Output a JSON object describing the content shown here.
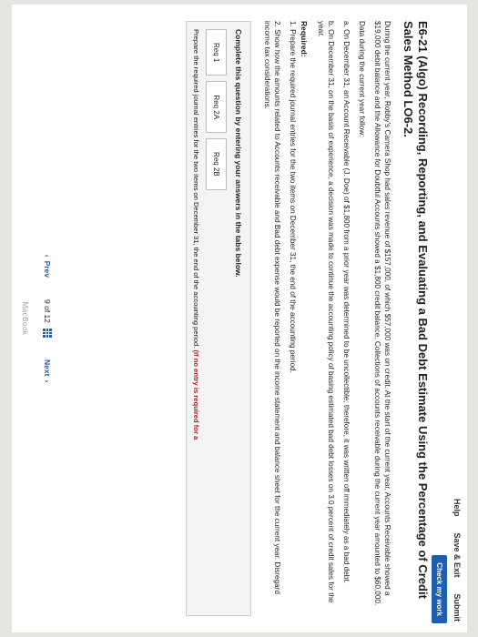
{
  "header": {
    "help": "Help",
    "save_exit": "Save & Exit",
    "submit": "Submit",
    "check_my_work": "Check my work"
  },
  "problem": {
    "title": "E6-21 (Algo) Recording, Reporting, and Evaluating a Bad Debt Estimate Using the Percentage of Credit Sales Method LO6-2.",
    "intro": "During the current year, Robby’s Camera Shop had sales revenue of $157,000, of which $57,000 was on credit. At the start of the current year, Accounts Receivable showed a $19,000 debit balance and the Allowance for Doubtful Accounts showed a $1,800 credit balance. Collections of accounts receivable during the current year amounted to $60,000.",
    "data_label": "Data during the current year follow:",
    "item_a": "a. On December 31, an Account Receivable (J. Doe) of $1,800 from a prior year was determined to be uncollectible; therefore, it was written off immediately as a bad debt.",
    "item_b": "b. On December 31, on the basis of experience, a decision was made to continue the accounting policy of basing estimated bad debt losses on 3.0 percent of credit sales for the year.",
    "required_title": "Required:",
    "req_1": "1. Prepare the required journal entries for the two items on December 31, the end of the accounting period.",
    "req_2": "2. Show how the amounts related to Accounts receivable and Bad debt expense would be reported on the income statement and balance sheet for the current year. Disregard income tax considerations."
  },
  "panel": {
    "title": "Complete this question by entering your answers in the tabs below.",
    "tabs": [
      "Req 1",
      "Req 2A",
      "Req 2B"
    ],
    "instruction_main": "Prepare the required journal entries for the two items on December 31, the end of the accounting period.",
    "instruction_red": "(If no entry is required for a"
  },
  "footer": {
    "prev": "Prev",
    "page": "9 of 12",
    "next": "Next"
  },
  "device": {
    "label": "MacBook"
  },
  "icons": {
    "prev": "chevron-left-icon",
    "next": "chevron-right-icon",
    "grid": "grid-icon"
  },
  "colors": {
    "accent": "#1f5fae",
    "warning": "#b11b1b"
  }
}
